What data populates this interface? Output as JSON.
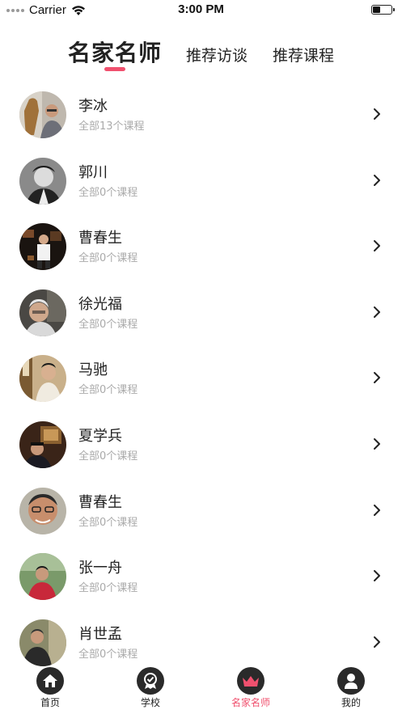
{
  "status_bar": {
    "carrier": "Carrier",
    "time": "3:00 PM"
  },
  "top_tabs": [
    {
      "label": "名家名师",
      "active": true
    },
    {
      "label": "推荐访谈",
      "active": false
    },
    {
      "label": "推荐课程",
      "active": false
    }
  ],
  "accent_color": "#f0506e",
  "teachers": [
    {
      "name": "李冰",
      "courses": "全部13个课程"
    },
    {
      "name": "郭川",
      "courses": "全部0个课程"
    },
    {
      "name": "曹春生",
      "courses": "全部0个课程"
    },
    {
      "name": "徐光福",
      "courses": "全部0个课程"
    },
    {
      "name": "马驰",
      "courses": "全部0个课程"
    },
    {
      "name": "夏学兵",
      "courses": "全部0个课程"
    },
    {
      "name": "曹春生",
      "courses": "全部0个课程"
    },
    {
      "name": "张一舟",
      "courses": "全部0个课程"
    },
    {
      "name": "肖世孟",
      "courses": "全部0个课程"
    }
  ],
  "bottom_nav": [
    {
      "label": "首页",
      "icon": "home-icon",
      "active": false
    },
    {
      "label": "学校",
      "icon": "school-badge-icon",
      "active": false
    },
    {
      "label": "名家名师",
      "icon": "crown-icon",
      "active": true
    },
    {
      "label": "我的",
      "icon": "user-icon",
      "active": false
    }
  ]
}
